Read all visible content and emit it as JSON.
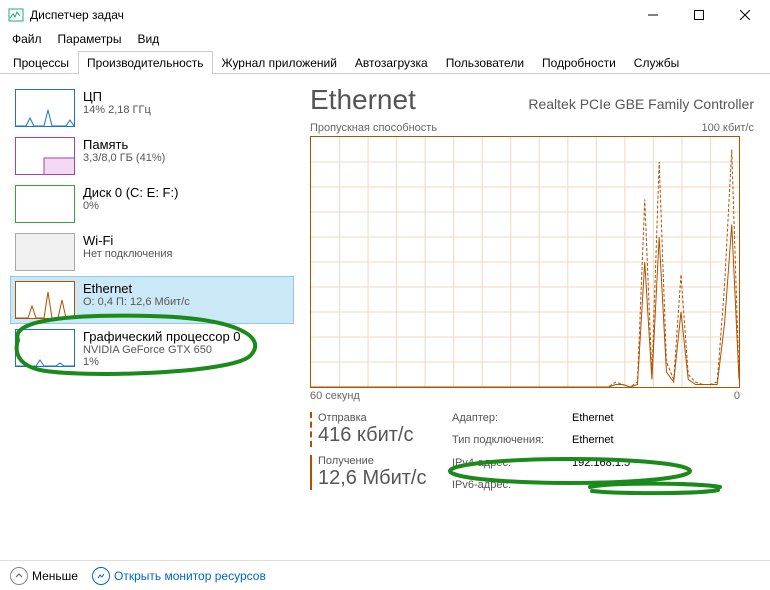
{
  "window": {
    "title": "Диспетчер задач"
  },
  "menu": {
    "file": "Файл",
    "options": "Параметры",
    "view": "Вид"
  },
  "tabs": {
    "processes": "Процессы",
    "performance": "Производительность",
    "app_history": "Журнал приложений",
    "startup": "Автозагрузка",
    "users": "Пользователи",
    "details": "Подробности",
    "services": "Службы"
  },
  "sidebar": {
    "cpu": {
      "title": "ЦП",
      "sub": "14% 2,18 ГГц"
    },
    "mem": {
      "title": "Память",
      "sub": "3,3/8,0 ГБ (41%)"
    },
    "disk": {
      "title": "Диск 0 (C: E: F:)",
      "sub": "0%"
    },
    "wifi": {
      "title": "Wi-Fi",
      "sub": "Нет подключения"
    },
    "eth": {
      "title": "Ethernet",
      "sub": "О: 0,4 П: 12,6 Мбит/с"
    },
    "gpu": {
      "title": "Графический процессор 0",
      "sub": "NVIDIA GeForce GTX 650",
      "sub2": "1%"
    }
  },
  "detail": {
    "title": "Ethernet",
    "adapter_full": "Realtek PCIe GBE Family Controller",
    "chart_header_left": "Пропускная способность",
    "chart_header_right": "100 кбит/с",
    "chart_footer_left": "60 секунд",
    "chart_footer_right": "0",
    "send_label": "Отправка",
    "send_value": "416 кбит/с",
    "recv_label": "Получение",
    "recv_value": "12,6 Мбит/с",
    "info": {
      "adapter_k": "Адаптер:",
      "adapter_v": "Ethernet",
      "conn_k": "Тип подключения:",
      "conn_v": "Ethernet",
      "ipv4_k": "IPv4-адрес:",
      "ipv4_v": "192.168.1.5",
      "ipv6_k": "IPv6-адрес:",
      "ipv6_v": ""
    }
  },
  "footer": {
    "fewer": "Меньше",
    "resmon": "Открыть монитор ресурсов"
  },
  "chart_data": {
    "type": "line",
    "title": "Пропускная способность",
    "xlabel": "60 секунд",
    "ylabel": "",
    "ylim": [
      0,
      100
    ],
    "x_range_seconds": [
      60,
      0
    ],
    "series": [
      {
        "name": "Отправка",
        "style": "dashed",
        "values": [
          0,
          0,
          0,
          0,
          0,
          0,
          0,
          0,
          0,
          0,
          0,
          0,
          0,
          0,
          0,
          0,
          0,
          0,
          0,
          0,
          0,
          0,
          0,
          0,
          0,
          0,
          0,
          0,
          0,
          0,
          0,
          0,
          0,
          0,
          0,
          0,
          0,
          0,
          0,
          0,
          0,
          0,
          2,
          1,
          0,
          2,
          75,
          5,
          90,
          10,
          3,
          45,
          5,
          2,
          1,
          1,
          2,
          40,
          95,
          4
        ]
      },
      {
        "name": "Получение",
        "style": "solid",
        "values": [
          0,
          0,
          0,
          0,
          0,
          0,
          0,
          0,
          0,
          0,
          0,
          0,
          0,
          0,
          0,
          0,
          0,
          0,
          0,
          0,
          0,
          0,
          0,
          0,
          0,
          0,
          0,
          0,
          0,
          0,
          0,
          0,
          0,
          0,
          0,
          0,
          0,
          0,
          0,
          0,
          0,
          0,
          1,
          1,
          0,
          1,
          50,
          3,
          60,
          6,
          2,
          30,
          3,
          1,
          1,
          1,
          1,
          25,
          65,
          3
        ]
      }
    ]
  }
}
